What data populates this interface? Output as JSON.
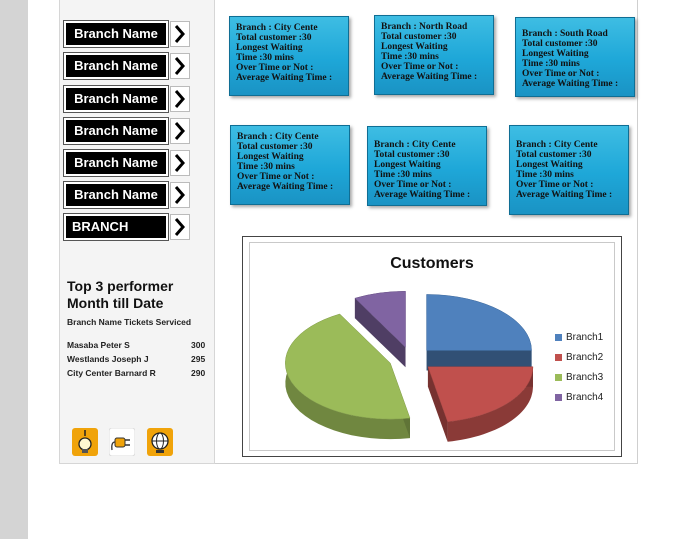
{
  "sidebar": {
    "branch_buttons": [
      "Branch Name",
      "Branch Name",
      "Branch Name",
      "Branch Name",
      "Branch Name",
      "Branch Name",
      "BRANCH"
    ],
    "top_title_line1": "Top 3  performer",
    "top_title_line2": "Month till Date",
    "table_header": "Branch   Name Tickets Serviced",
    "rows": [
      {
        "name": "Masaba    Peter S",
        "tickets": "300"
      },
      {
        "name": "Westlands Joseph J",
        "tickets": "295"
      },
      {
        "name": "City Center Barnard R",
        "tickets": "290"
      }
    ],
    "icons": [
      "lightbulb-icon",
      "plug-icon",
      "globe-icon"
    ]
  },
  "cards": [
    {
      "branch": "Branch    : City Cente",
      "customers": "Total customer :30",
      "longest": "Longest Waiting",
      "time": "Time :30 mins",
      "overtime": "Over Time or Not :",
      "average": "Average Waiting Time :"
    },
    {
      "branch": "Branch    : North Road",
      "customers": "Total customer :30",
      "longest": "Longest Waiting",
      "time": "Time :30 mins",
      "overtime": "Over Time or Not :",
      "average": "Average Waiting Time :"
    },
    {
      "branch": "Branch    : South Road",
      "customers": "Total customer :30",
      "longest": "Longest Waiting",
      "time": "Time :30 mins",
      "overtime": "Over Time or Not :",
      "average": "Average Waiting Time :"
    },
    {
      "branch": "Branch    : City Cente",
      "customers": "Total customer :30",
      "longest": "Longest Waiting",
      "time": "Time :30 mins",
      "overtime": "Over Time or Not :",
      "average": "Average Waiting Time :"
    },
    {
      "branch": "Branch    : City Cente",
      "customers": "Total customer :30",
      "longest": "Longest Waiting",
      "time": "Time :30 mins",
      "overtime": "Over Time or Not :",
      "average": "Average Waiting Time :"
    },
    {
      "branch": "Branch    : City Cente",
      "customers": "Total customer :30",
      "longest": "Longest Waiting",
      "time": "Time :30 mins",
      "overtime": "Over Time or Not :",
      "average": "Average Waiting Time :"
    }
  ],
  "colors": {
    "card_blue": "#2bb3e0",
    "branch1": "#4f81bd",
    "branch2": "#c0504d",
    "branch3": "#9bbb59",
    "branch4": "#8064a2"
  },
  "chart_data": {
    "type": "pie",
    "title": "Customers",
    "categories": [
      "Branch1",
      "Branch2",
      "Branch3",
      "Branch4"
    ],
    "values": [
      25,
      22,
      45,
      8
    ],
    "colors": [
      "#4f81bd",
      "#c0504d",
      "#9bbb59",
      "#8064a2"
    ],
    "exploded": true,
    "three_d": true,
    "legend_position": "right"
  }
}
